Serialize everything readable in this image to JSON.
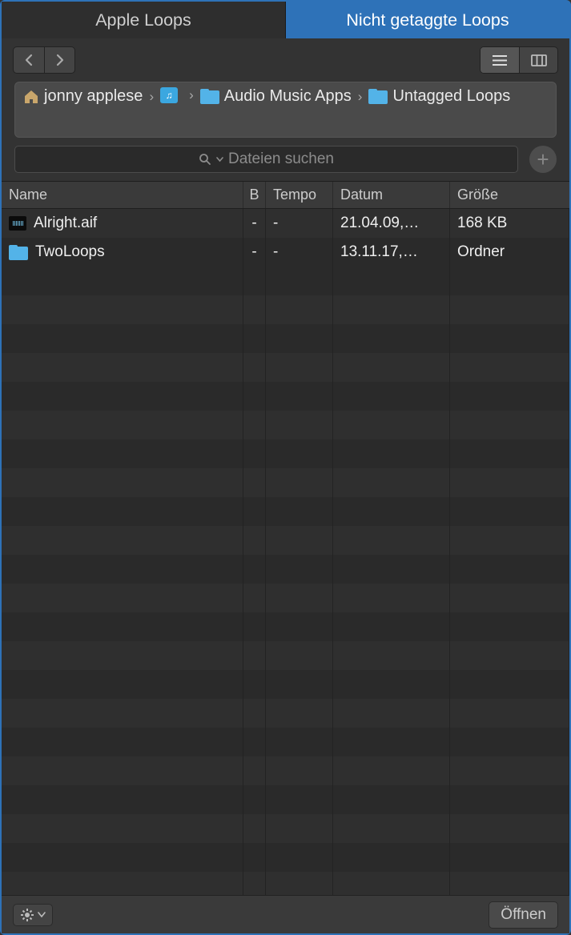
{
  "tabs": [
    {
      "label": "Apple Loops",
      "active": false
    },
    {
      "label": "Nicht getaggte Loops",
      "active": true
    }
  ],
  "breadcrumbs": [
    {
      "label": "jonny applese",
      "icon": "home"
    },
    {
      "label": "",
      "icon": "music"
    },
    {
      "label": "Audio Music Apps",
      "icon": "folder"
    },
    {
      "label": "Untagged Loops",
      "icon": "folder"
    }
  ],
  "search": {
    "placeholder": "Dateien suchen"
  },
  "columns": {
    "name": "Name",
    "b": "B",
    "tempo": "Tempo",
    "date": "Datum",
    "size": "Größe"
  },
  "rows": [
    {
      "icon": "audio",
      "name": "Alright.aif",
      "b": "-",
      "tempo": "-",
      "date": "21.04.09,…",
      "size": "168 KB"
    },
    {
      "icon": "folder",
      "name": "TwoLoops",
      "b": "-",
      "tempo": "-",
      "date": "13.11.17,…",
      "size": "Ordner"
    }
  ],
  "footer": {
    "open": "Öffnen"
  }
}
